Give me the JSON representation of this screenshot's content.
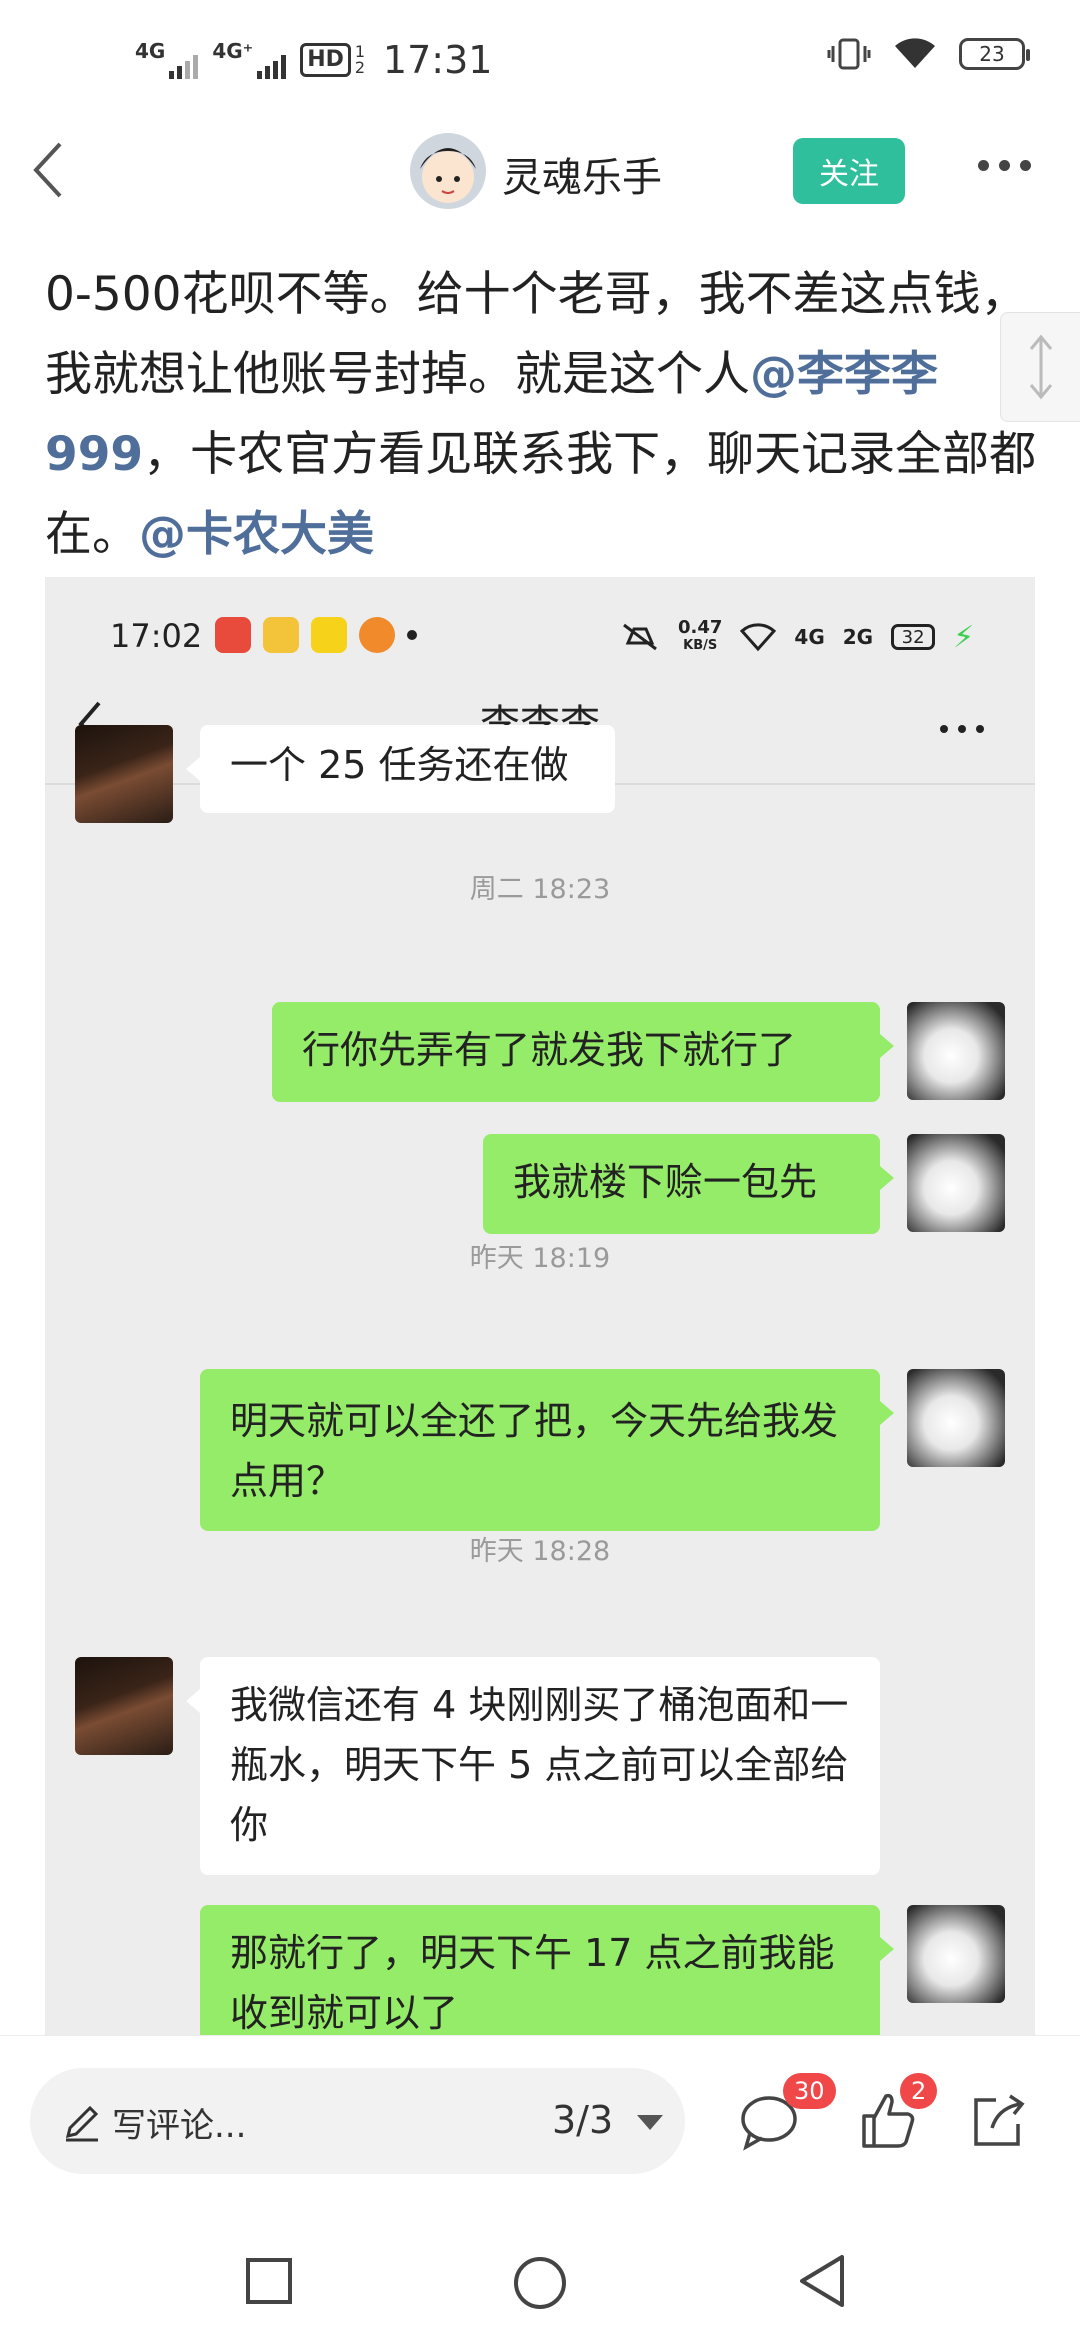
{
  "status_bar": {
    "time": "17:31",
    "signal1_label": "4G",
    "signal2_label": "4G⁺",
    "hd_label": "HD",
    "hd_sub": "1 2",
    "battery": "23"
  },
  "header": {
    "author_name": "灵魂乐手",
    "follow_label": "关注"
  },
  "post": {
    "text_1": "0-500花呗不等。给十个老哥，我不差这点钱，我就想让他账号封掉。就是这个人",
    "mention_1": "@李李李999",
    "text_2": "，卡农官方看见联系我下，聊天记录全部都在。",
    "mention_2": "@卡农大美"
  },
  "screenshot": {
    "status": {
      "time": "17:02",
      "speed_value": "0.47",
      "speed_unit": "KB/S",
      "net1": "4G",
      "net2": "2G",
      "battery": "32"
    },
    "chat_title": "李李李",
    "messages": [
      {
        "side": "in",
        "text": "一个 25 任务还在做"
      },
      {
        "stamp": "周二 18:23"
      },
      {
        "side": "out",
        "text": "行你先弄有了就发我下就行了"
      },
      {
        "side": "out",
        "text": "我就楼下赊一包先"
      },
      {
        "stamp": "昨天 18:19"
      },
      {
        "side": "out",
        "text": "明天就可以全还了把，今天先给我发点用？"
      },
      {
        "stamp": "昨天 18:28"
      },
      {
        "side": "in",
        "text": "我微信还有 4 块刚刚买了桶泡面和一瓶水，明天下午 5 点之前可以全部给你"
      },
      {
        "side": "out",
        "text": "那就行了，明天下午 17 点之前我能收到就可以了"
      }
    ]
  },
  "bottom_bar": {
    "comment_placeholder": "写评论...",
    "page_indicator": "3/3",
    "comment_count": "30",
    "like_count": "2"
  },
  "colors": {
    "follow_button": "#2fbf9c",
    "mention": "#4f6e9a",
    "bubble_out": "#95ec69",
    "bubble_in": "#ffffff",
    "badge": "#f04848"
  },
  "icons": [
    "back-arrow-icon",
    "more-icon",
    "comment-icon",
    "like-icon",
    "share-icon",
    "pen-icon",
    "square-nav-icon",
    "circle-nav-icon",
    "triangle-nav-icon"
  ]
}
